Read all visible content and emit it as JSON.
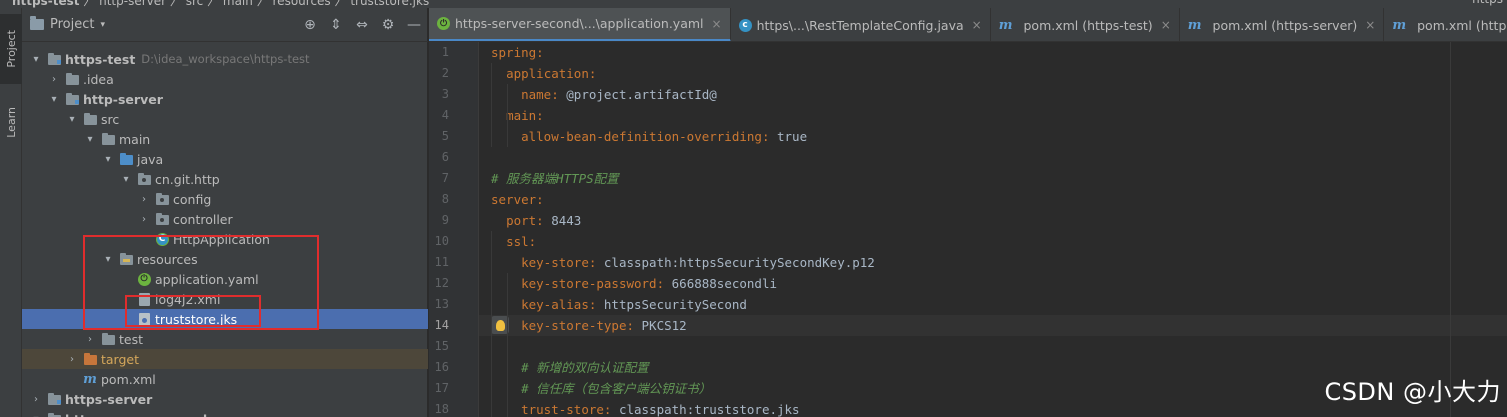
{
  "breadcrumb": {
    "items": [
      "https-test",
      "http-server",
      "src",
      "main",
      "resources",
      "truststore.jks"
    ],
    "right_cut": "https"
  },
  "stripe": {
    "project_tab": "Project",
    "learn_tab": "Learn"
  },
  "project_panel": {
    "title": "Project",
    "caret": "▾",
    "tools": {
      "locate": "⊕",
      "expand": "⇕",
      "collapse": "⇔",
      "settings": "⚙",
      "hide": "—"
    }
  },
  "tree": [
    {
      "label": "https-test",
      "path": "D:\\idea_workspace\\https-test",
      "arrow": "▾",
      "icon": "module-folder-icon",
      "bold": true
    },
    {
      "label": ".idea",
      "arrow": "›",
      "icon": "folder-icon"
    },
    {
      "label": "http-server",
      "arrow": "▾",
      "icon": "module-folder-icon",
      "bold": true
    },
    {
      "label": "src",
      "arrow": "▾",
      "icon": "folder-icon"
    },
    {
      "label": "main",
      "arrow": "▾",
      "icon": "folder-icon"
    },
    {
      "label": "java",
      "arrow": "▾",
      "icon": "source-folder-icon"
    },
    {
      "label": "cn.git.http",
      "arrow": "▾",
      "icon": "package-icon"
    },
    {
      "label": "config",
      "arrow": "›",
      "icon": "package-icon"
    },
    {
      "label": "controller",
      "arrow": "›",
      "icon": "package-icon"
    },
    {
      "label": "HttpApplication",
      "arrow": "",
      "icon": "spring-boot-class-icon"
    },
    {
      "label": "resources",
      "arrow": "▾",
      "icon": "resources-folder-icon"
    },
    {
      "label": "application.yaml",
      "arrow": "",
      "icon": "spring-config-icon"
    },
    {
      "label": "log4j2.xml",
      "arrow": "",
      "icon": "xml-file-icon"
    },
    {
      "label": "truststore.jks",
      "arrow": "",
      "icon": "keystore-file-icon",
      "selected": true
    },
    {
      "label": "test",
      "arrow": "›",
      "icon": "folder-icon"
    },
    {
      "label": "target",
      "arrow": "›",
      "icon": "excluded-folder-icon",
      "orange": true
    },
    {
      "label": "pom.xml",
      "arrow": "",
      "icon": "maven-pom-icon"
    },
    {
      "label": "https-server",
      "arrow": "›",
      "icon": "module-folder-icon",
      "bold": true
    },
    {
      "label": "https-server-second",
      "arrow": "▾",
      "icon": "module-folder-icon",
      "bold": true
    }
  ],
  "tabs": [
    {
      "label": "https-server-second\\...\\application.yaml",
      "icon": "spring-config-icon",
      "active": true,
      "close": "×"
    },
    {
      "label": "https\\...\\RestTemplateConfig.java",
      "icon": "java-class-icon",
      "close": "×"
    },
    {
      "label": "pom.xml (https-test)",
      "icon": "maven-pom-icon",
      "close": "×"
    },
    {
      "label": "pom.xml (https-server)",
      "icon": "maven-pom-icon",
      "close": "×"
    },
    {
      "label": "pom.xml (https-server-second)",
      "icon": "maven-pom-icon",
      "close": ""
    }
  ],
  "editor": {
    "current_line": 14,
    "lines": [
      {
        "n": "1",
        "indent": "",
        "key": "spring",
        "sep": ":",
        "val": ""
      },
      {
        "n": "2",
        "indent": "  ",
        "key": "application",
        "sep": ":",
        "val": ""
      },
      {
        "n": "3",
        "indent": "    ",
        "key": "name",
        "sep": ": ",
        "val": "@project.artifactId@"
      },
      {
        "n": "4",
        "indent": "  ",
        "key": "main",
        "sep": ":",
        "val": ""
      },
      {
        "n": "5",
        "indent": "    ",
        "key": "allow-bean-definition-overriding",
        "sep": ": ",
        "val": "true"
      },
      {
        "n": "6",
        "indent": "",
        "key": "",
        "sep": "",
        "val": ""
      },
      {
        "n": "7",
        "indent": "",
        "comment": "# 服务器端HTTPS配置"
      },
      {
        "n": "8",
        "indent": "",
        "key": "server",
        "sep": ":",
        "val": ""
      },
      {
        "n": "9",
        "indent": "  ",
        "key": "port",
        "sep": ": ",
        "val": "8443"
      },
      {
        "n": "10",
        "indent": "  ",
        "key": "ssl",
        "sep": ":",
        "val": ""
      },
      {
        "n": "11",
        "indent": "    ",
        "key": "key-store",
        "sep": ": ",
        "val": "classpath:httpsSecuritySecondKey.p12"
      },
      {
        "n": "12",
        "indent": "    ",
        "key": "key-store-password",
        "sep": ": ",
        "val": "666888secondli"
      },
      {
        "n": "13",
        "indent": "    ",
        "key": "key-alias",
        "sep": ": ",
        "val": "httpsSecuritySecond"
      },
      {
        "n": "14",
        "indent": "    ",
        "key": "key-store-type",
        "sep": ": ",
        "val": "PKCS12"
      },
      {
        "n": "15",
        "indent": "",
        "key": "",
        "sep": "",
        "val": ""
      },
      {
        "n": "16",
        "indent": "    ",
        "comment": "# 新增的双向认证配置"
      },
      {
        "n": "17",
        "indent": "    ",
        "comment": "# 信任库（包含客户端公钥证书）"
      },
      {
        "n": "18",
        "indent": "    ",
        "key": "trust-store",
        "sep": ": ",
        "val": "classpath:truststore.jks"
      }
    ]
  },
  "watermark": "CSDN @小大力",
  "colors": {
    "yaml_key": "#cc7832",
    "yaml_value": "#a9b7c6",
    "comment": "#629755",
    "selection": "#4b6eaf",
    "annotation_box": "#e02d2d"
  }
}
